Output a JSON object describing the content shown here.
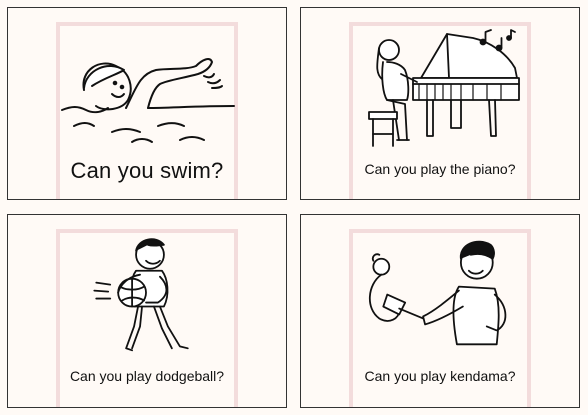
{
  "cards": [
    {
      "caption": "Can you swim?",
      "illustration": "swimming-child"
    },
    {
      "caption": "Can you play the piano?",
      "illustration": "girl-playing-piano"
    },
    {
      "caption": "Can you play dodgeball?",
      "illustration": "boy-with-ball"
    },
    {
      "caption": "Can you play kendama?",
      "illustration": "boy-with-kendama"
    }
  ],
  "colors": {
    "background": "#fffaf6",
    "border": "#333333",
    "frame": "#f3dcdc"
  }
}
